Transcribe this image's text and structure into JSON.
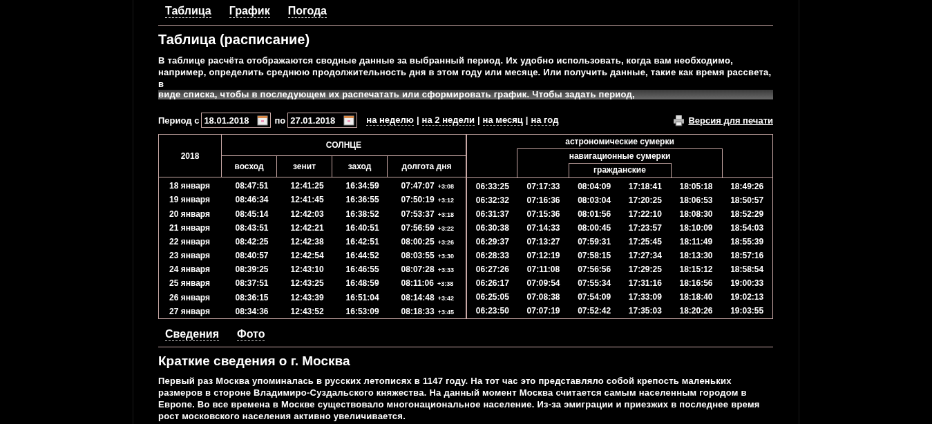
{
  "tabs": [
    {
      "label": "Таблица"
    },
    {
      "label": "График"
    },
    {
      "label": "Погода"
    }
  ],
  "heading": "Таблица (расписание)",
  "intro": "В таблице расчёта отображаются сводные данные за выбранный период. Их удобно использовать, когда вам необходимо, например, определить среднюю продолжительность дня в этом году или месяце. Или получить данные, такие как время рассвета, в",
  "intro_faded": "виде списка, чтобы в последующем их распечатать или сформировать график. Чтобы задать период,",
  "period": {
    "label_from": "Период с",
    "from": "18.01.2018",
    "label_to": "по",
    "to": "27.01.2018",
    "ranges": [
      "на неделю",
      "на 2 недели",
      "на месяц",
      "на год"
    ],
    "separator": "|",
    "print": "Версия для печати"
  },
  "sun_table": {
    "year": "2018",
    "group": "СОЛНЦЕ",
    "columns": [
      "восход",
      "зенит",
      "заход",
      "долгота дня"
    ],
    "rows": [
      {
        "date": "18 января",
        "cells": [
          "08:47:51",
          "12:41:25",
          "16:34:59",
          "07:47:07"
        ],
        "delta": "+3:08"
      },
      {
        "date": "19 января",
        "cells": [
          "08:46:34",
          "12:41:45",
          "16:36:55",
          "07:50:19"
        ],
        "delta": "+3:12"
      },
      {
        "date": "20 января",
        "cells": [
          "08:45:14",
          "12:42:03",
          "16:38:52",
          "07:53:37"
        ],
        "delta": "+3:18"
      },
      {
        "date": "21 января",
        "cells": [
          "08:43:51",
          "12:42:21",
          "16:40:51",
          "07:56:59"
        ],
        "delta": "+3:22"
      },
      {
        "date": "22 января",
        "cells": [
          "08:42:25",
          "12:42:38",
          "16:42:51",
          "08:00:25"
        ],
        "delta": "+3:26"
      },
      {
        "date": "23 января",
        "cells": [
          "08:40:57",
          "12:42:54",
          "16:44:52",
          "08:03:55"
        ],
        "delta": "+3:30"
      },
      {
        "date": "24 января",
        "cells": [
          "08:39:25",
          "12:43:10",
          "16:46:55",
          "08:07:28"
        ],
        "delta": "+3:33"
      },
      {
        "date": "25 января",
        "cells": [
          "08:37:51",
          "12:43:25",
          "16:48:59",
          "08:11:06"
        ],
        "delta": "+3:38"
      },
      {
        "date": "26 января",
        "cells": [
          "08:36:15",
          "12:43:39",
          "16:51:04",
          "08:14:48"
        ],
        "delta": "+3:42"
      },
      {
        "date": "27 января",
        "cells": [
          "08:34:36",
          "12:43:52",
          "16:53:09",
          "08:18:33"
        ],
        "delta": "+3:45"
      }
    ]
  },
  "twilight_table": {
    "astronomical": "астрономические сумерки",
    "nautical": "навигационные сумерки",
    "civil": "гражданские",
    "rows": [
      [
        "06:33:25",
        "07:17:33",
        "08:04:09",
        "17:18:41",
        "18:05:18",
        "18:49:26"
      ],
      [
        "06:32:32",
        "07:16:36",
        "08:03:04",
        "17:20:25",
        "18:06:53",
        "18:50:57"
      ],
      [
        "06:31:37",
        "07:15:36",
        "08:01:56",
        "17:22:10",
        "18:08:30",
        "18:52:29"
      ],
      [
        "06:30:38",
        "07:14:33",
        "08:00:45",
        "17:23:57",
        "18:10:09",
        "18:54:03"
      ],
      [
        "06:29:37",
        "07:13:27",
        "07:59:31",
        "17:25:45",
        "18:11:49",
        "18:55:39"
      ],
      [
        "06:28:33",
        "07:12:19",
        "07:58:15",
        "17:27:34",
        "18:13:30",
        "18:57:16"
      ],
      [
        "06:27:26",
        "07:11:08",
        "07:56:56",
        "17:29:25",
        "18:15:12",
        "18:58:54"
      ],
      [
        "06:26:17",
        "07:09:54",
        "07:55:34",
        "17:31:16",
        "18:16:56",
        "19:00:33"
      ],
      [
        "06:25:05",
        "07:08:38",
        "07:54:09",
        "17:33:09",
        "18:18:40",
        "19:02:13"
      ],
      [
        "06:23:50",
        "07:07:19",
        "07:52:42",
        "17:35:03",
        "18:20:26",
        "19:03:55"
      ]
    ]
  },
  "info_tabs": [
    {
      "label": "Сведения"
    },
    {
      "label": "Фото"
    }
  ],
  "info_heading": "Краткие сведения о г. Москва",
  "info_text": "Первый раз Москва упоминалась в русских летописях в 1147 году. На тот час это представляло собой крепость маленьких размеров в стороне Владимиро-Суздальского княжества. На данный момент Москва считается самым населенным городом в Европе. Во все времена в Москве существовало многонациональное население. Из-за эмиграции и приезжих в последнее время рост московского населения активно увеличивается."
}
